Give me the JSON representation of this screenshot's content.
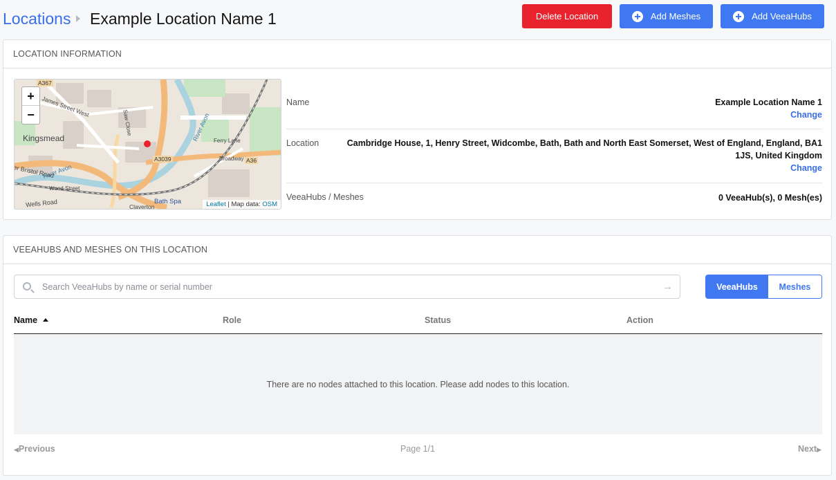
{
  "header": {
    "breadcrumb_root": "Locations",
    "breadcrumb_current": "Example Location Name 1",
    "delete_label": "Delete Location",
    "add_meshes_label": "Add Meshes",
    "add_veeahubs_label": "Add VeeaHubs"
  },
  "info": {
    "section_title": "LOCATION INFORMATION",
    "map": {
      "zoom_in": "+",
      "zoom_out": "−",
      "attribution_leaflet": "Leaflet",
      "attribution_text": "| Map data: ",
      "attribution_osm": "OSM",
      "labels": {
        "kingsmead": "Kingsmead",
        "a367": "A367",
        "a3039": "A3039",
        "a36": "A36",
        "james_street": "James Street West",
        "river_avon_1": "River Avon",
        "river_avon_2": "River Avon",
        "bristol_road": "er Bristol Road",
        "wood_street": "Wood Street",
        "wells_road": "Wells Road",
        "bath_spa": "Bath Spa",
        "broadway": "Broadway",
        "ferry_lane": "Ferry Lane",
        "claverton": "Claverton",
        "saw_close": "Saw Close"
      }
    },
    "rows": {
      "name_label": "Name",
      "name_value": "Example Location Name 1",
      "location_label": "Location",
      "location_value_line1": "Cambridge House, 1, Henry Street, Widcombe, Bath, Bath and North East Somerset, West of England, England, BA1",
      "location_value_line2": "1JS, United Kingdom",
      "counts_label": "VeeaHubs / Meshes",
      "counts_value": "0 VeeaHub(s), 0 Mesh(es)",
      "change_label": "Change"
    }
  },
  "nodes": {
    "section_title": "VEEAHUBS AND MESHES ON THIS LOCATION",
    "search_placeholder": "Search VeeaHubs by name or serial number",
    "toggle_veeahubs": "VeeaHubs",
    "toggle_meshes": "Meshes",
    "columns": [
      "Name",
      "Role",
      "Status",
      "Action"
    ],
    "empty_message": "There are no nodes attached to this location. Please add nodes to this location.",
    "pager": {
      "previous": "Previous",
      "page": "Page 1/1",
      "next": "Next"
    }
  },
  "colors": {
    "accent": "#3f78f0",
    "danger": "#e8232d",
    "marker": "#e8232d"
  }
}
